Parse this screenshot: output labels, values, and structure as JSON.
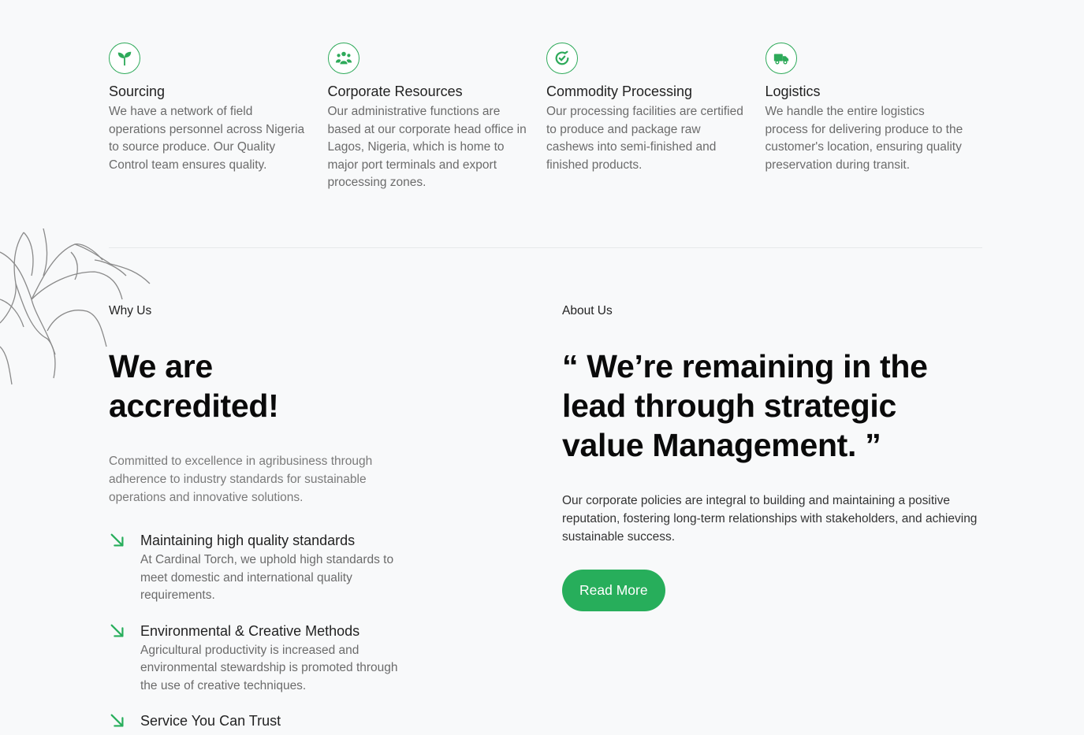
{
  "services": [
    {
      "icon": "sprout-icon",
      "title": "Sourcing",
      "desc": "We have a network of field operations personnel across Nigeria to source produce. Our Quality Control team ensures quality."
    },
    {
      "icon": "people-group-icon",
      "title": "Corporate Resources",
      "desc": "Our administrative functions are based at our corporate head office in Lagos, Nigeria, which is home to major port terminals and export processing zones."
    },
    {
      "icon": "processing-cycle-icon",
      "title": "Commodity Processing",
      "desc": "Our processing facilities are certified to produce and package raw cashews into semi-finished and finished products."
    },
    {
      "icon": "truck-icon",
      "title": "Logistics",
      "desc": "We handle the entire logistics process for delivering produce to the customer's location, ensuring quality preservation during transit."
    }
  ],
  "why_us": {
    "eyebrow": "Why Us",
    "heading_line1": "We are",
    "heading_line2": "accredited!",
    "intro": "Committed to excellence in agribusiness through adherence to industry standards for sustainable operations and innovative solutions.",
    "features": [
      {
        "title": "Maintaining high quality standards",
        "desc": "At Cardinal Torch, we uphold high standards to meet domestic and international quality requirements."
      },
      {
        "title": "Environmental & Creative Methods",
        "desc": "Agricultural productivity is increased and environmental stewardship is promoted through the use of creative techniques."
      },
      {
        "title": "Service You Can Trust",
        "desc": ""
      }
    ]
  },
  "about_us": {
    "eyebrow": "About Us",
    "quote": "“ We’re remaining in the lead through strategic value Management. ”",
    "desc": "Our corporate policies are integral to building and maintaining a positive reputation, fostering long-term relationships with stakeholders, and achieving sustainable success.",
    "button_label": "Read More"
  },
  "colors": {
    "accent": "#27ae5b",
    "background": "#f8f9fa",
    "muted_text": "#6b6b6b"
  }
}
